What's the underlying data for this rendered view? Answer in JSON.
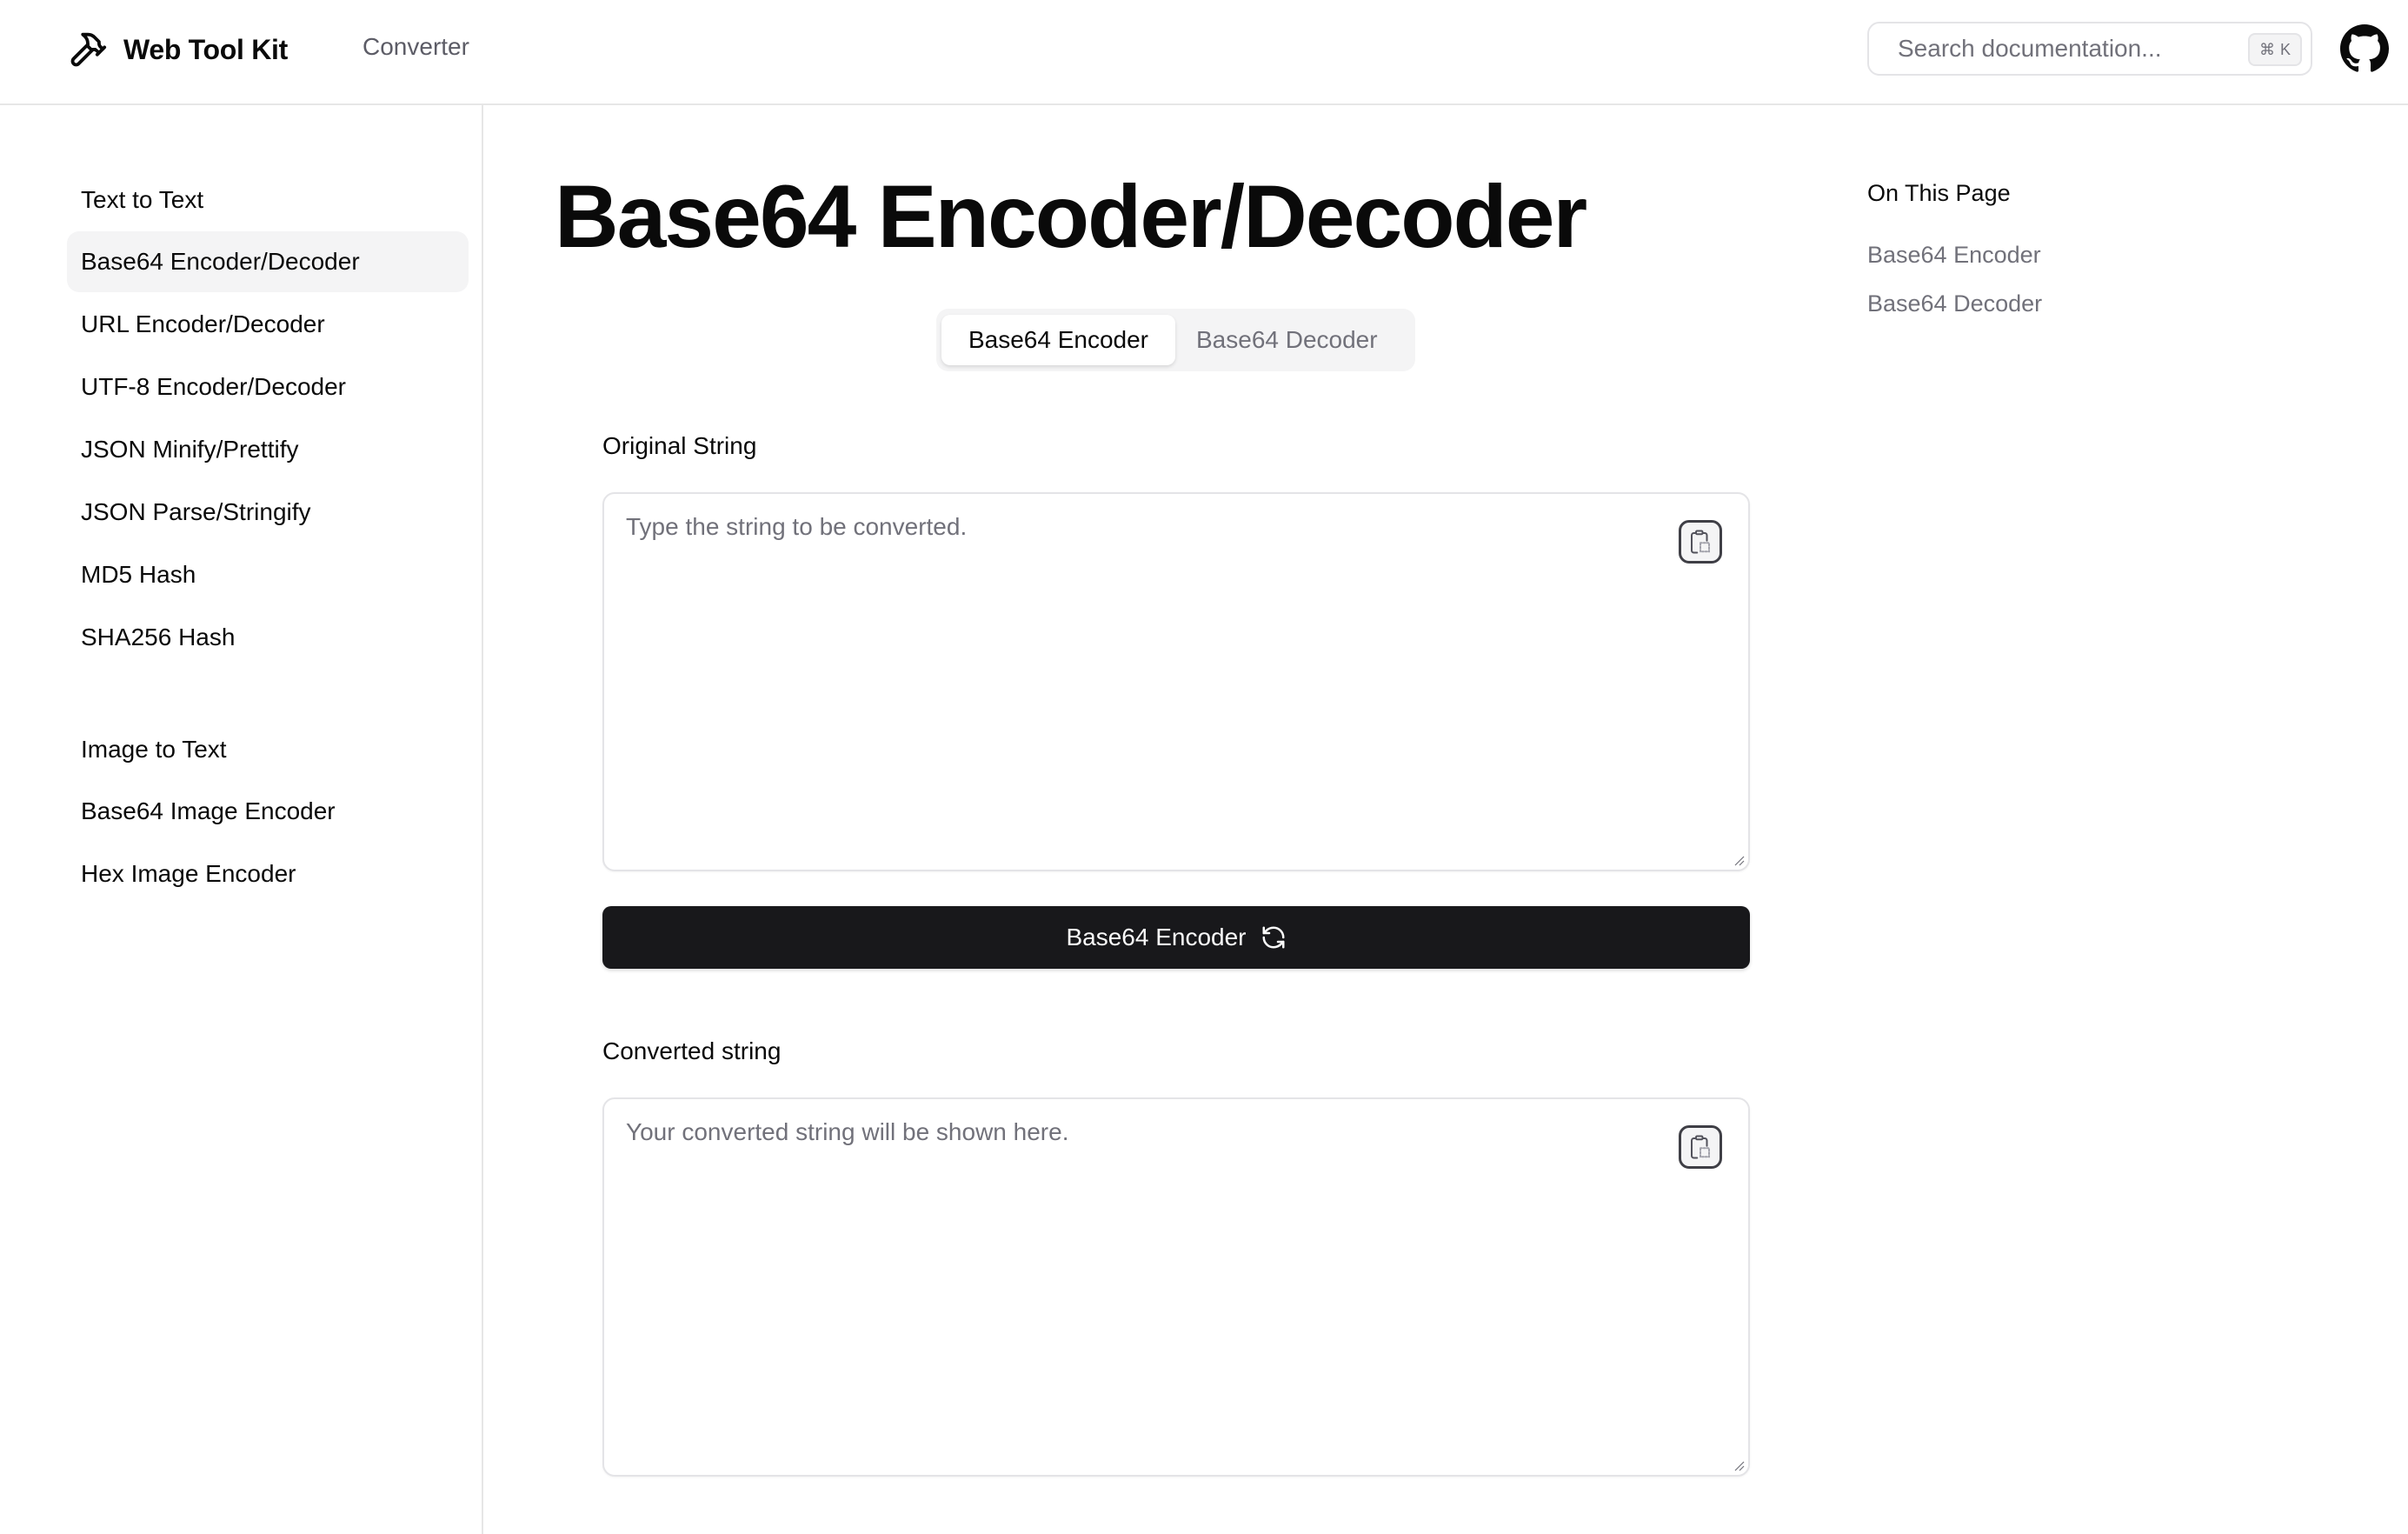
{
  "header": {
    "brand": "Web Tool Kit",
    "nav": [
      {
        "label": "Converter"
      }
    ],
    "search": {
      "placeholder": "Search documentation...",
      "shortcut_symbol": "⌘",
      "shortcut_key": "K"
    },
    "github_icon": "github-icon"
  },
  "sidebar": {
    "sections": [
      {
        "heading": "Text to Text",
        "items": [
          {
            "label": "Base64 Encoder/Decoder",
            "active": true
          },
          {
            "label": "URL Encoder/Decoder",
            "active": false
          },
          {
            "label": "UTF-8 Encoder/Decoder",
            "active": false
          },
          {
            "label": "JSON Minify/Prettify",
            "active": false
          },
          {
            "label": "JSON Parse/Stringify",
            "active": false
          },
          {
            "label": "MD5 Hash",
            "active": false
          },
          {
            "label": "SHA256 Hash",
            "active": false
          }
        ]
      },
      {
        "heading": "Image to Text",
        "items": [
          {
            "label": "Base64 Image Encoder",
            "active": false
          },
          {
            "label": "Hex Image Encoder",
            "active": false
          }
        ]
      }
    ]
  },
  "main": {
    "title": "Base64 Encoder/Decoder",
    "tabs": [
      {
        "label": "Base64 Encoder",
        "active": true
      },
      {
        "label": "Base64 Decoder",
        "active": false
      }
    ],
    "input": {
      "label": "Original String",
      "value": "",
      "placeholder": "Type the string to be converted."
    },
    "action_button": {
      "label": "Base64 Encoder",
      "icon": "refresh-icon"
    },
    "output": {
      "label": "Converted string",
      "value": "",
      "placeholder": "Your converted string will be shown here."
    }
  },
  "toc": {
    "heading": "On This Page",
    "items": [
      {
        "label": "Base64 Encoder"
      },
      {
        "label": "Base64 Decoder"
      }
    ]
  },
  "colors": {
    "primary_button": "#18181b",
    "muted_text": "#71717a",
    "border": "#e4e4e7",
    "active_bg": "#f4f4f5"
  }
}
